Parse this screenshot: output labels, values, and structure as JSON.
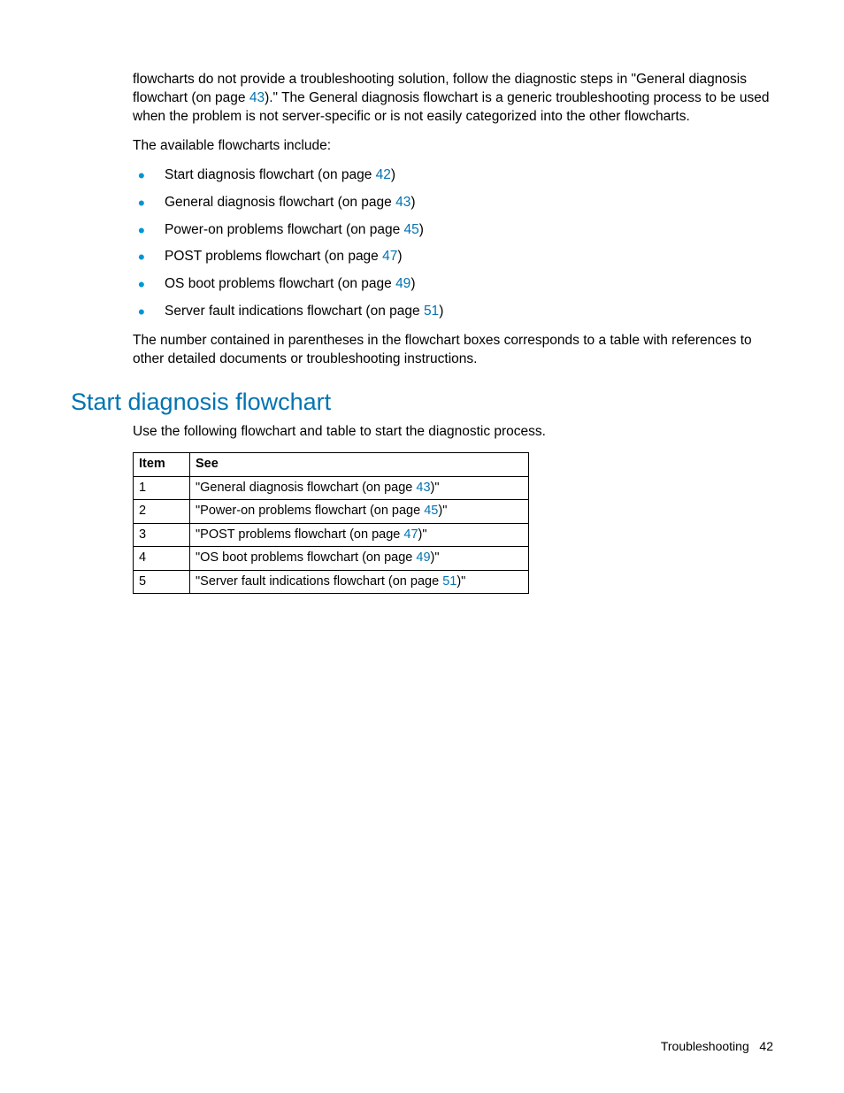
{
  "intro": {
    "para1_a": "flowcharts do not provide a troubleshooting solution, follow the diagnostic steps in \"General diagnosis flowchart (on page ",
    "para1_link": "43",
    "para1_b": ").\" The General diagnosis flowchart is a generic troubleshooting process to be used when the problem is not server-specific or is not easily categorized into the other flowcharts.",
    "para2": "The available flowcharts include:",
    "list": [
      {
        "text": "Start diagnosis flowchart (on page ",
        "page": "42",
        "after": ")"
      },
      {
        "text": "General diagnosis flowchart (on page ",
        "page": "43",
        "after": ")"
      },
      {
        "text": "Power-on problems flowchart (on page ",
        "page": "45",
        "after": ")"
      },
      {
        "text": "POST problems flowchart (on page ",
        "page": "47",
        "after": ")"
      },
      {
        "text": "OS boot problems flowchart (on page ",
        "page": "49",
        "after": ")"
      },
      {
        "text": "Server fault indications flowchart (on page ",
        "page": "51",
        "after": ")"
      }
    ],
    "para3": "The number contained in parentheses in the flowchart boxes corresponds to a table with references to other detailed documents or troubleshooting instructions."
  },
  "section": {
    "title": "Start diagnosis flowchart",
    "lead": "Use the following flowchart and table to start the diagnostic process.",
    "table": {
      "head_item": "Item",
      "head_see": "See",
      "rows": [
        {
          "n": "1",
          "pre": "\"General diagnosis flowchart (on page ",
          "page": "43",
          "post": ")\""
        },
        {
          "n": "2",
          "pre": "\"Power-on problems flowchart (on page ",
          "page": "45",
          "post": ")\""
        },
        {
          "n": "3",
          "pre": "\"POST problems flowchart (on page ",
          "page": "47",
          "post": ")\""
        },
        {
          "n": "4",
          "pre": "\"OS boot problems flowchart (on page ",
          "page": "49",
          "post": ")\""
        },
        {
          "n": "5",
          "pre": "\"Server fault indications flowchart (on page ",
          "page": "51",
          "post": ")\""
        }
      ]
    }
  },
  "footer": {
    "section": "Troubleshooting",
    "page": "42"
  }
}
